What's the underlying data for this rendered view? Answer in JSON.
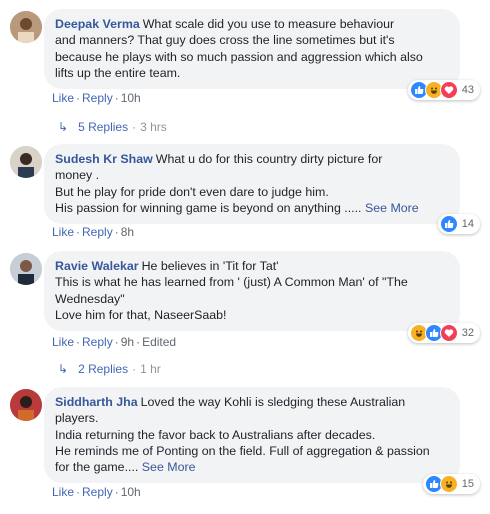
{
  "comments": [
    {
      "author": "Deepak Verma",
      "lines": [
        "What scale did you use to measure behaviour",
        "and manners? That guy does cross the line sometimes but it's",
        "because he plays with so much passion and aggression which also",
        "lifts up the entire team."
      ],
      "like": "Like",
      "reply": "Reply",
      "time": "10h",
      "reaction_count": "43",
      "reaction_icons": [
        "like-icon",
        "haha-icon",
        "love-icon"
      ],
      "replies_label": "5 Replies",
      "replies_time": "3 hrs"
    },
    {
      "author": "Sudesh Kr Shaw",
      "lines": [
        "What u do for this country dirty picture for",
        "money .",
        "But he play for pride don't even dare to judge him.",
        "His passion for winning game is beyond on anything ....."
      ],
      "see_more": "See More",
      "like": "Like",
      "reply": "Reply",
      "time": "8h",
      "reaction_count": "14",
      "reaction_icons": [
        "like-icon"
      ]
    },
    {
      "author": "Ravie Walekar",
      "lines": [
        "He believes in 'Tit for Tat'",
        "This is what he has learned from ' (just) A Common Man' of \"The",
        "Wednesday\"",
        "Love him for that, NaseerSaab!"
      ],
      "like": "Like",
      "reply": "Reply",
      "time": "9h",
      "edited": "Edited",
      "reaction_count": "32",
      "reaction_icons": [
        "haha-icon",
        "like-icon",
        "love-icon"
      ],
      "replies_label": "2 Replies",
      "replies_time": "1 hr"
    },
    {
      "author": "Siddharth Jha",
      "lines": [
        "Loved the way Kohli is sledging these Australian",
        "players.",
        "India returning the favor back to Australians after decades.",
        "He reminds me of Ponting on the field. Full of aggregation & passion",
        "for the game...."
      ],
      "see_more": "See More",
      "like": "Like",
      "reply": "Reply",
      "time": "10h",
      "reaction_count": "15",
      "reaction_icons": [
        "like-icon",
        "haha-icon"
      ]
    }
  ],
  "colors": {
    "name_link": "#365899",
    "action_link": "#4267b2",
    "bubble_bg": "#f2f3f5",
    "muted": "#90949c",
    "like_blue": "#2d88ff",
    "haha_yellow": "#f7b125",
    "love_red": "#f33e58"
  }
}
